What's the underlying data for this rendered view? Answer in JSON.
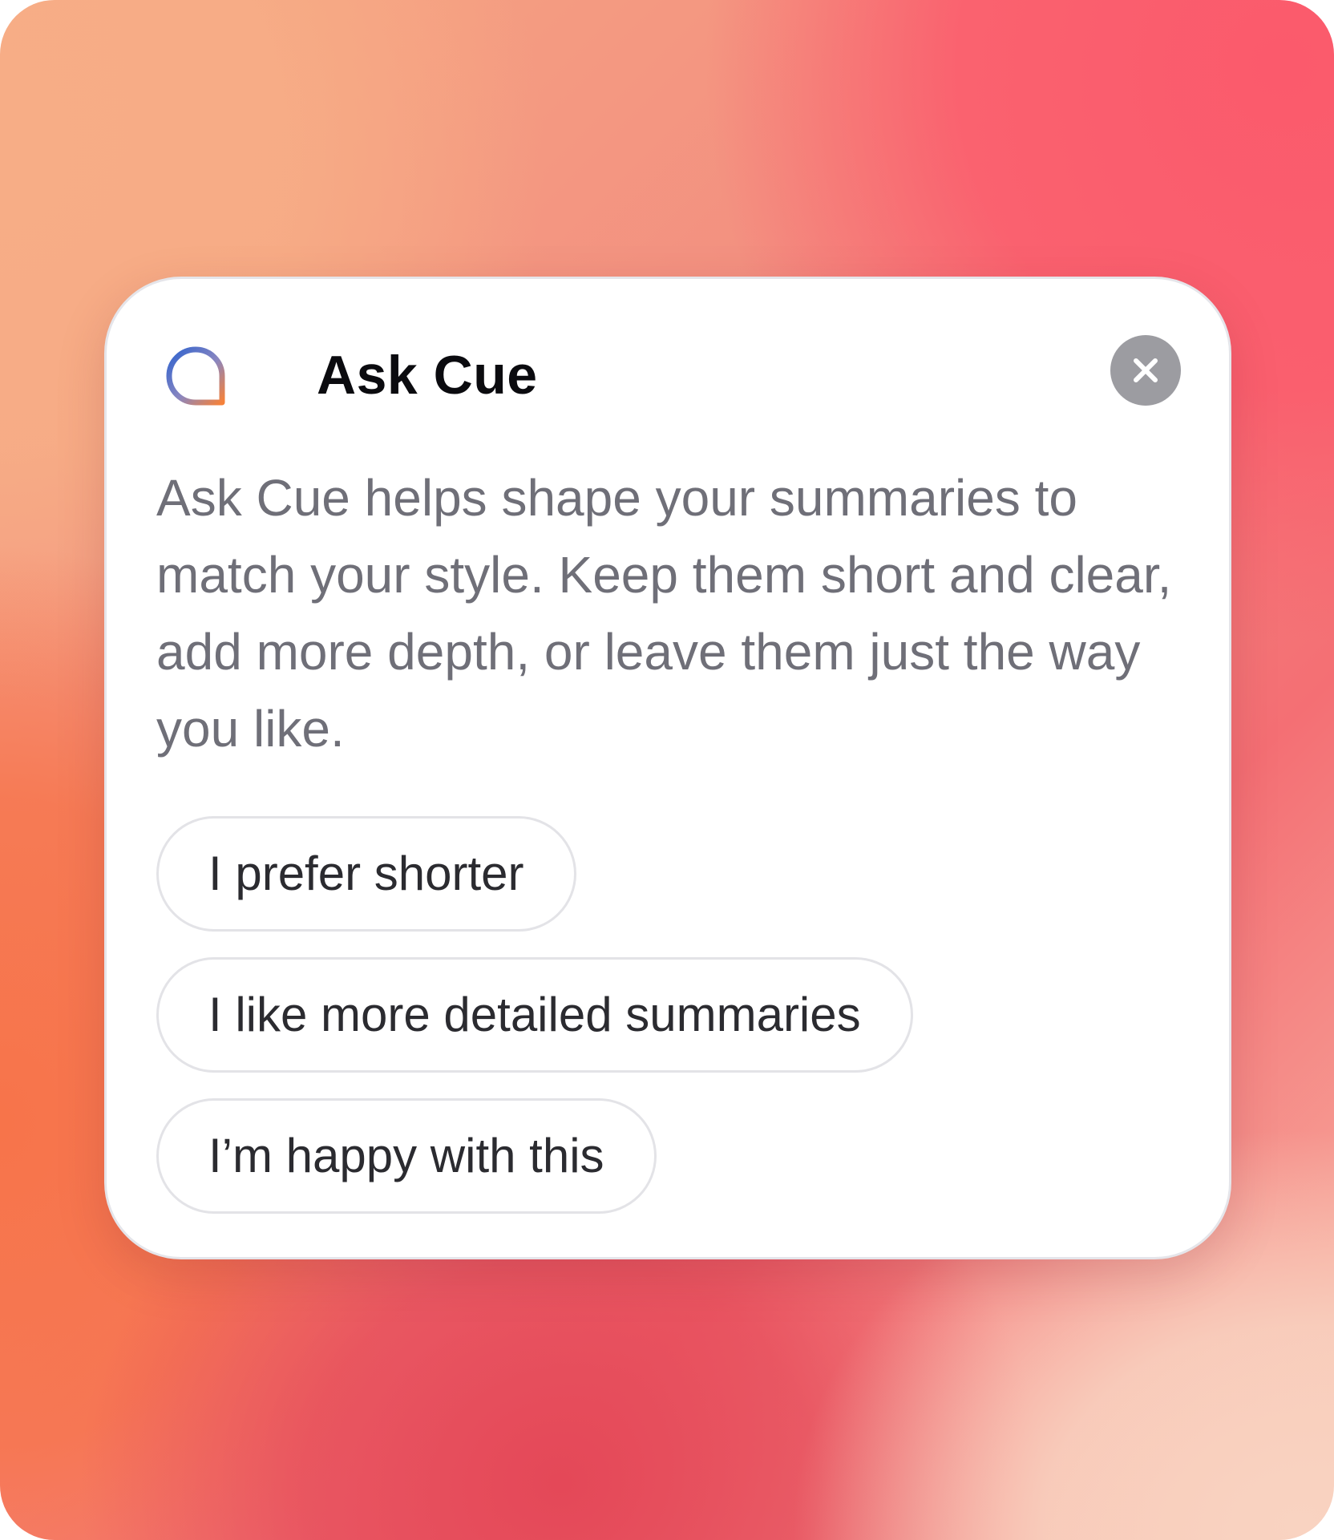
{
  "dialog": {
    "title": "Ask Cue",
    "logo_icon": "cue-chat-bubble-icon",
    "close_icon": "close-x-icon",
    "description": "Ask Cue helps shape your summaries to match your style. Keep them short and clear, add more depth, or leave them just the way you like.",
    "options": [
      {
        "label": "I prefer shorter"
      },
      {
        "label": "I like more detailed summaries"
      },
      {
        "label": "I’m happy with this"
      }
    ]
  },
  "colors": {
    "logo_gradient_start": "#3b6fd4",
    "logo_gradient_end": "#f5813a",
    "close_button_bg": "#9c9ca1",
    "title_text": "#0b0b0f",
    "body_text": "#6f6f78",
    "option_text": "#2b2b30",
    "option_border": "#e3e3e7"
  }
}
